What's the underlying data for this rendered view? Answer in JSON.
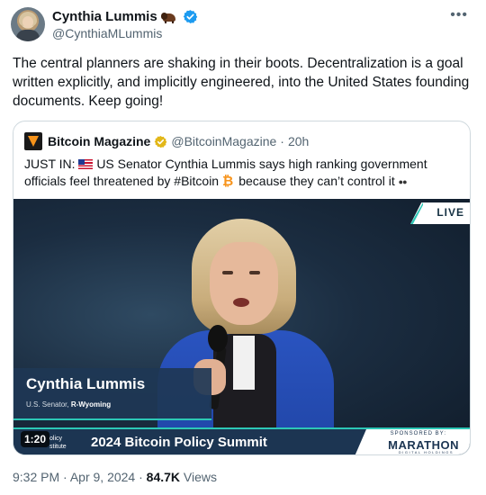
{
  "author": {
    "name": "Cynthia Lummis",
    "handle": "@CynthiaMLummis",
    "name_emoji": "bison-icon",
    "verified": "verified-blue"
  },
  "post": {
    "text": "The central planners are shaking in their boots. Decentralization is a goal written explicitly, and implicitly engineered, into the United States founding documents. Keep going!"
  },
  "quoted": {
    "name": "Bitcoin Magazine",
    "handle": "@BitcoinMagazine",
    "separator": "·",
    "time": "20h",
    "text_prefix": "JUST IN:",
    "text_main": "US Senator Cynthia Lummis says high ranking government officials feel threatened by #Bitcoin",
    "text_suffix": "because they can’t control it",
    "video": {
      "live_label": "LIVE",
      "lower_third_name": "Cynthia Lummis",
      "lower_third_title_prefix": "U.S. Senator,",
      "lower_third_title_bold": "R-Wyoming",
      "institute_line1": "olicy",
      "institute_line2": "stitute",
      "summit_title": "2024 Bitcoin Policy Summit",
      "sponsor_label": "SPONSORED BY:",
      "sponsor_name": "MARATHON",
      "sponsor_sub": "DIGITAL HOLDINGS",
      "duration": "1:20"
    }
  },
  "meta": {
    "time": "9:32 PM",
    "date": "Apr 9, 2024",
    "views_count": "84.7K",
    "views_label": "Views",
    "separator": "·"
  },
  "colors": {
    "text": "#0f1419",
    "muted": "#536471",
    "border": "#cfd9de",
    "verified_blue": "#1d9bf0",
    "verified_gold": "#e2b719",
    "accent_teal": "#2cc7b6"
  }
}
